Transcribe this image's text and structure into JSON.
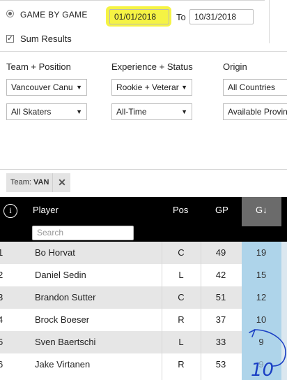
{
  "mode": {
    "option_label": "GAME BY GAME",
    "sum_label": "Sum Results",
    "sum_checked_glyph": "✓"
  },
  "dates": {
    "from": "01/01/2018",
    "to_label": "To",
    "to": "10/31/2018",
    "highlight_color": "#f4f23a"
  },
  "filters": {
    "team_position": {
      "title": "Team + Position",
      "team": "Vancouver Canu",
      "position": "All Skaters"
    },
    "experience_status": {
      "title": "Experience + Status",
      "experience": "Rookie + Veterar",
      "time": "All-Time"
    },
    "origin": {
      "title": "Origin",
      "country": "All Countries",
      "province": "Available Provin"
    },
    "dropdown_arrow": "▼"
  },
  "active_tag": {
    "key": "Team:",
    "value": "VAN",
    "close_glyph": "✕"
  },
  "table": {
    "info_glyph": "i",
    "columns": {
      "player": "Player",
      "pos": "Pos",
      "gp": "GP",
      "g": "G↓"
    },
    "search_placeholder": "Search",
    "rows": [
      {
        "rank": "1",
        "player": "Bo Horvat",
        "pos": "C",
        "gp": "49",
        "g": "19"
      },
      {
        "rank": "2",
        "player": "Daniel Sedin",
        "pos": "L",
        "gp": "42",
        "g": "15"
      },
      {
        "rank": "3",
        "player": "Brandon Sutter",
        "pos": "C",
        "gp": "51",
        "g": "12"
      },
      {
        "rank": "4",
        "player": "Brock Boeser",
        "pos": "R",
        "gp": "37",
        "g": "10"
      },
      {
        "rank": "5",
        "player": "Sven Baertschi",
        "pos": "L",
        "gp": "33",
        "g": "9"
      },
      {
        "rank": "6",
        "player": "Jake Virtanen",
        "pos": "R",
        "gp": "53",
        "g": "9"
      }
    ],
    "row_colors": {
      "odd": "#e6e6e6",
      "even": "#ffffff",
      "sorted_col": "#aed4ea"
    }
  },
  "annotation": {
    "handwritten_value": "10",
    "ink_color": "#1a3fc4"
  }
}
